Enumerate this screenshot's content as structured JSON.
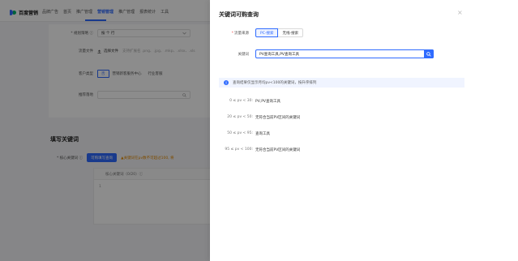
{
  "app": {
    "logo_text": "百度营销",
    "nav": [
      "品牌广告",
      "首页",
      "推广管理",
      "营销管理",
      "推广管理",
      "报表统计",
      "工具"
    ],
    "nav_active_index": 3
  },
  "bg_form": {
    "strategy_label": "* 规划策略 ⓘ",
    "strategy_value": "按 个 行",
    "file_label": "流量文件",
    "upload_label": "选择文件",
    "upload_hint": "支持扩展名 .png、.jpg、.mkp、.xlsx、.xls",
    "account_label": "客户类型",
    "account_opts": [
      "否",
      "营销新客服务中心",
      "行业客服"
    ],
    "landing_label": "推荐落地",
    "section_title": "填写关键词",
    "core_kw_label": "* 核心关键词 ⓘ",
    "core_kw_btn": "可购填写查询",
    "core_kw_warn": "▲关键词在pv数不可超过100, 将",
    "table_head": "核心关键词（0/20）ⓘ",
    "table_rownum": "1"
  },
  "drawer": {
    "title": "关键词可购查询",
    "close": "×",
    "source_label": "流量来源",
    "source_required": "*",
    "source_opts": [
      "PC-搜索",
      "无线-搜索"
    ],
    "source_selected": 0,
    "keyword_label": "关键词",
    "keyword_value": "PV查询工具,PV查询工具",
    "info_text": "查询结果仅显示月均pv<100的关键词，按升序排列",
    "ranges": [
      {
        "label": "0 ≤ pv < 30:",
        "value": "PV,PV查询工具"
      },
      {
        "label": "20 ≤ pv < 50:",
        "value": "无符合当前PV区间的关键词"
      },
      {
        "label": "50 ≤ pv < 95:",
        "value": "查询工具"
      },
      {
        "label": "95 ≤ pv < 100:",
        "value": "无符合当前PV区间的关键词"
      }
    ]
  },
  "colors": {
    "primary": "#2f6bff",
    "overlay": "rgba(0,0,0,0.45)",
    "warn": "#e58a00"
  },
  "icons": [
    "close-icon",
    "search-icon",
    "info-icon",
    "upload-icon",
    "chevron-down-icon",
    "logo-icon"
  ]
}
